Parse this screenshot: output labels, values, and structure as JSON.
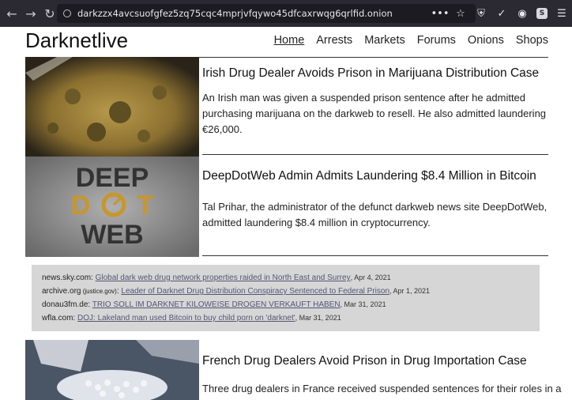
{
  "browser": {
    "url": "darkzzx4avcsuofgfez5zq75cqc4mprjvfqywo45dfcaxrwqg6qrlfid.onion",
    "more": "•••"
  },
  "site": {
    "brand": "Darknetlive",
    "nav": [
      "Home",
      "Arrests",
      "Markets",
      "Forums",
      "Onions",
      "Shops"
    ]
  },
  "articles": [
    {
      "title": "Irish Drug Dealer Avoids Prison in Marijuana Distribution Case",
      "summary": "An Irish man was given a suspended prison sentence after he admitted purchasing marijuana on the darkweb to resell. He also admitted laundering €26,000."
    },
    {
      "title": "DeepDotWeb Admin Admits Laundering $8.4 Million in Bitcoin",
      "summary": "Tal Prihar, the administrator of the defunct darkweb news site DeepDotWeb, admitted laundering $8.4 million in cryptocurrency.",
      "logo_lines": [
        "DEEP",
        "D",
        "T",
        "WEB"
      ]
    },
    {
      "title": "French Drug Dealers Avoid Prison in Drug Importation Case",
      "summary": "Three drug dealers in France received suspended sentences for their roles in a"
    }
  ],
  "news": [
    {
      "source": "news.sky.com:",
      "note": "",
      "link": "Global dark web drug network properties raided in North East and Surrey",
      "date": ", Apr 4, 2021"
    },
    {
      "source": "archive.org",
      "note": " (justice.gov)",
      "after": ":",
      "link": "Leader of Darknet Drug Distribution Conspiracy Sentenced to Federal Prison",
      "date": ", Apr 1, 2021"
    },
    {
      "source": "donau3fm.de:",
      "note": "",
      "link": "TRIO SOLL IM DARKNET KILOWEISE DROGEN VERKAUFT HABEN",
      "date": ", Mar 31, 2021"
    },
    {
      "source": "wfla.com:",
      "note": "",
      "link": "DOJ: Lakeland man used Bitcoin to buy child porn on 'darknet'",
      "date": ", Mar 31, 2021"
    }
  ],
  "colors": {
    "chrome": "#2b2a33",
    "urlbar": "#1c1b22",
    "news_box": "#d6d6d6",
    "link": "#555577"
  }
}
